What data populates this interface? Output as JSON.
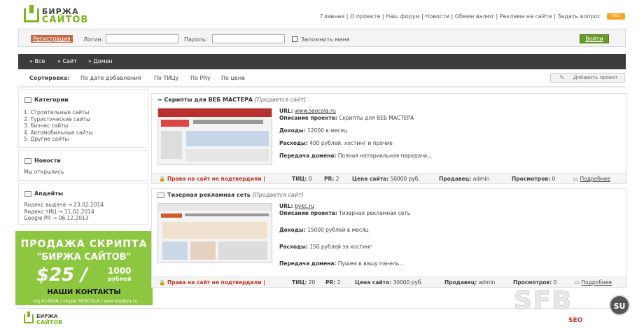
{
  "brand": {
    "line1": "БИРЖА",
    "line2": "САЙТОВ"
  },
  "topnav": [
    "Главная",
    "О проекте",
    "Наш форум",
    "Новости",
    "Обмен валют",
    "Реклама на сайте",
    "Задать вопрос"
  ],
  "topnav_sep": "|",
  "rss_label": "RSS",
  "login": {
    "register_label": "Регистрация",
    "login_label": "Логин:",
    "login_value": "",
    "password_label": "Пароль:",
    "password_value": "",
    "remember_label": "Запомнить меня",
    "submit_label": "Войти"
  },
  "categories_bar": [
    "» Все",
    "» Сайт",
    "» Домен"
  ],
  "sort": {
    "label": "Сортировка:",
    "options": [
      "По дате добавления",
      "По ТИЦу",
      "По PRу",
      "По цене"
    ],
    "add_project": "Добавить проект"
  },
  "sidebar": {
    "categories_title": "Категории",
    "categories": [
      "1. Строительные сайты",
      "2. Туристические сайты",
      "3. Бизнес сайты",
      "4. Автомобильные сайты",
      "5. Другие сайты"
    ],
    "news_title": "Новости",
    "news_text": "Мы открылись",
    "updates_title": "Апдейты",
    "updates": [
      "Яндекс выдача → 23.02.2014",
      "Яндекс тИЦ → 11.02.2014",
      "Google PR → 06.12.2013"
    ]
  },
  "promo": {
    "line1": "ПРОДАЖА СКРИПТА",
    "line2": "\"БИРЖА САЙТОВ\"",
    "price": "$25 /",
    "price_rub": "1000",
    "price_rub_unit": "рублей",
    "contacts_title": "НАШИ КОНТАКТЫ",
    "contacts": "icq 614936 / skype SEOCOLA / seocola@ya.ru"
  },
  "listings": [
    {
      "title": "Скрипты для ВЕБ МАСТЕРА",
      "status": "[Продается сайт]",
      "url_label": "URL:",
      "url": "www.seocola.ru",
      "desc_label": "Описание проекта:",
      "desc": "Скрипты для ВЕБ МАСТЕРА",
      "income_label": "Доходы:",
      "income": "12000 в месяц",
      "expense_label": "Расходы:",
      "expense": "400 рублей, хостинг и прочие",
      "domain_label": "Передача домена:",
      "domain": "Полная нотариальная передача...",
      "rights": "Права на сайт не подтвердили",
      "tic_label": "ТИЦ:",
      "tic": "0",
      "pr_label": "PR:",
      "pr": "2",
      "price_label": "Цена сайта:",
      "price": "50000 руб.",
      "seller_label": "Продавец:",
      "seller": "admin",
      "views_label": "Просмотров:",
      "views": "0",
      "more": "Подробнее"
    },
    {
      "title": "Тизерная рекламная сеть",
      "status": "[Продается сайт]",
      "url_label": "URL:",
      "url": "bykc.ru",
      "desc_label": "Описание проекта:",
      "desc": "Тизерная рекламная сеть",
      "income_label": "Доходы:",
      "income": "15000 рублей в месяц",
      "expense_label": "Расходы:",
      "expense": "150 рублей за хостинг",
      "domain_label": "Передача домена:",
      "domain": "Пушем в вашу панель...",
      "rights": "Права на сайт не подтвердили",
      "tic_label": "ТИЦ:",
      "tic": "20",
      "pr_label": "PR:",
      "pr": "2",
      "price_label": "Цена сайта:",
      "price": "30000 руб.",
      "seller_label": "Продавец:",
      "seller": "admin",
      "views_label": "Просмотров:",
      "views": "0",
      "more": "Подробнее"
    }
  ],
  "footer_brand": {
    "line1": "БИРЖА",
    "line2": "САЙТОВ"
  },
  "watermark": {
    "text": "SFB",
    "badge": "SU",
    "corner": "SEO"
  },
  "colors": {
    "accent": "#7cb51e",
    "dark_bar": "#3d3d3d",
    "register": "#c66944",
    "alert": "#c0392b",
    "promo": "#8dc63f"
  }
}
